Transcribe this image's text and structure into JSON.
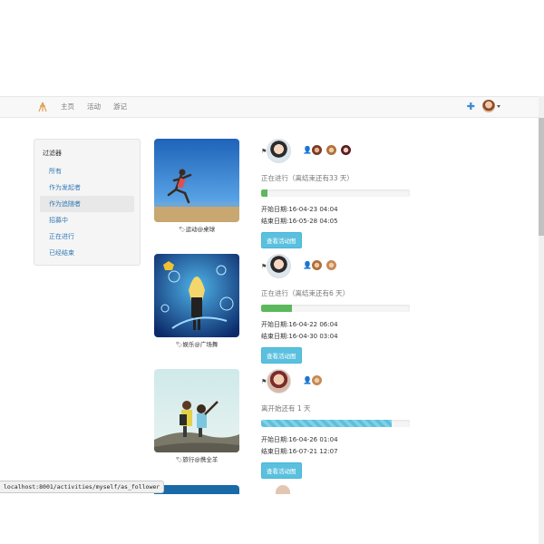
{
  "nav": {
    "brand_icon": "tripod-logo-icon",
    "links": [
      "主页",
      "活动",
      "游记"
    ],
    "plus_icon": "plus-icon",
    "accent": "#3a8ad1"
  },
  "sidebar": {
    "title": "过滤器",
    "items": [
      {
        "label": "所有"
      },
      {
        "label": "作为发起者"
      },
      {
        "label": "作为追随者",
        "active": true
      },
      {
        "label": "招募中"
      },
      {
        "label": "正在进行"
      },
      {
        "label": "已经结束"
      }
    ]
  },
  "activities": [
    {
      "caption": "运动@桌球",
      "status": "正在进行（离结束还有33 天）",
      "progress": 0.04,
      "bar_color": "#5cb85c",
      "start": "开始日期:16-04-23 04:04",
      "end": "结束日期:16-05-28 04:05",
      "button": "查看活动图"
    },
    {
      "caption": "娱乐@广场舞",
      "status": "正在进行（离结束还有6 天）",
      "progress": 0.21,
      "bar_color": "#5cb85c",
      "start": "开始日期:16-04-22 06:04",
      "end": "结束日期:16-04-30 03:04",
      "button": "查看活动图"
    },
    {
      "caption": "旅行@携全羊",
      "status": "离开始还有 1 天",
      "progress": 0.88,
      "bar_color": "#5bc0de",
      "start": "开始日期:16-04-26 01:04",
      "end": "结束日期:16-07-21 12:07",
      "button": "查看活动图"
    }
  ],
  "statusbar": {
    "url": "localhost:8001/activities/myself/as_follower"
  }
}
